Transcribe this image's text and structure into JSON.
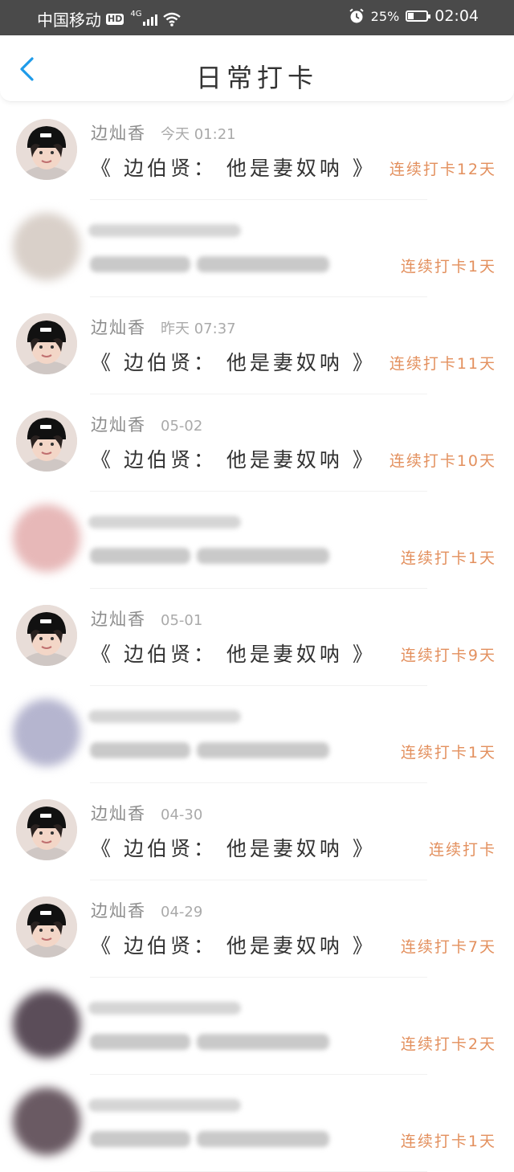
{
  "status_bar": {
    "carrier": "中国移动",
    "hd": "HD",
    "network": "4G",
    "battery_percent": "25%",
    "time": "02:04"
  },
  "header": {
    "title": "日常打卡"
  },
  "feed": {
    "items": [
      {
        "visible": true,
        "username": "边灿香",
        "time": "今天 01:21",
        "content": "《 边伯贤： 他是妻奴呐 》",
        "streak": "连续打卡12天"
      },
      {
        "visible": false,
        "streak": "连续打卡1天"
      },
      {
        "visible": true,
        "username": "边灿香",
        "time": "昨天 07:37",
        "content": "《 边伯贤： 他是妻奴呐 》",
        "streak": "连续打卡11天"
      },
      {
        "visible": true,
        "username": "边灿香",
        "time": "05-02",
        "content": "《 边伯贤： 他是妻奴呐 》",
        "streak": "连续打卡10天"
      },
      {
        "visible": false,
        "streak": "连续打卡1天"
      },
      {
        "visible": true,
        "username": "边灿香",
        "time": "05-01",
        "content": "《 边伯贤： 他是妻奴呐 》",
        "streak": "连续打卡9天"
      },
      {
        "visible": false,
        "streak": "连续打卡1天"
      },
      {
        "visible": true,
        "username": "边灿香",
        "time": "04-30",
        "content": "《 边伯贤： 他是妻奴呐 》",
        "streak": "连续打卡"
      },
      {
        "visible": true,
        "username": "边灿香",
        "time": "04-29",
        "content": "《 边伯贤： 他是妻奴呐 》",
        "streak": "连续打卡7天"
      },
      {
        "visible": false,
        "streak": "连续打卡2天"
      },
      {
        "visible": false,
        "streak": "连续打卡1天"
      }
    ]
  },
  "colors": {
    "status_bar_bg": "#4a4a4a",
    "accent_back": "#1e9be9",
    "streak_text": "#e3905e",
    "username_text": "#8c8c8c"
  }
}
